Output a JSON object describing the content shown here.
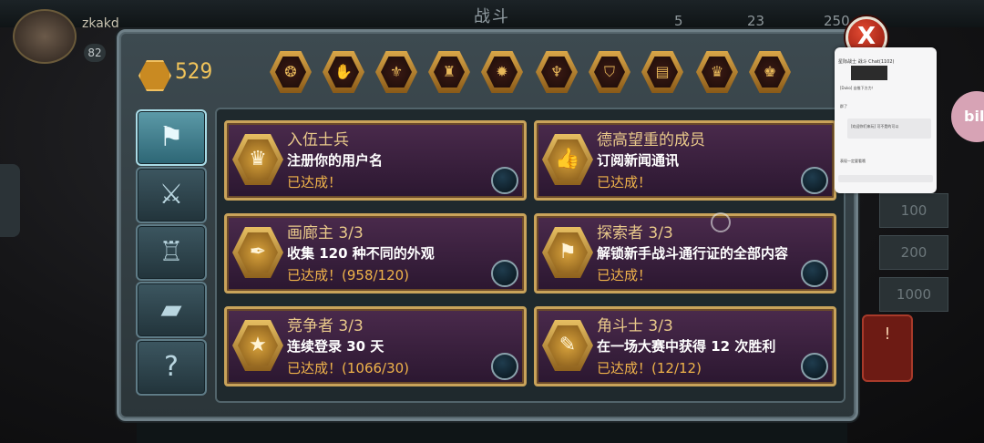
{
  "background": {
    "screen_title": "战斗",
    "username": "zkakd",
    "player_level": "82",
    "stats": [
      "5",
      "23",
      "250"
    ],
    "costs": [
      "100",
      "200",
      "1000"
    ],
    "side_logo": "bili",
    "red_button_text": "!"
  },
  "header": {
    "coin_amount": "529",
    "close_symbol": "X",
    "badges": [
      {
        "icon": "wreath-icon",
        "glyph": "❂"
      },
      {
        "icon": "hand-icon",
        "glyph": "✋"
      },
      {
        "icon": "winged-helmet-icon",
        "glyph": "⚜"
      },
      {
        "icon": "helmet-icon",
        "glyph": "♜"
      },
      {
        "icon": "gear-skull-icon",
        "glyph": "✹"
      },
      {
        "icon": "wings-icon",
        "glyph": "♆"
      },
      {
        "icon": "shield-icon",
        "glyph": "⛉"
      },
      {
        "icon": "book-icon",
        "glyph": "▤"
      },
      {
        "icon": "eagle-icon",
        "glyph": "♛"
      },
      {
        "icon": "crown-icon",
        "glyph": "♚"
      }
    ]
  },
  "sidebar": {
    "items": [
      {
        "id": "banner",
        "glyph": "⚑",
        "active": true
      },
      {
        "id": "swords",
        "glyph": "⚔",
        "active": false
      },
      {
        "id": "armor",
        "glyph": "♖",
        "active": false
      },
      {
        "id": "cards",
        "glyph": "▰",
        "active": false
      },
      {
        "id": "help",
        "glyph": "?",
        "active": false
      }
    ]
  },
  "achievements": [
    {
      "title": "入伍士兵",
      "desc": "注册你的用户名",
      "status": "已达成！",
      "icon": "eagle-badge-icon",
      "glyph": "♛"
    },
    {
      "title": "德高望重的成员",
      "desc": "订阅新闻通讯",
      "status": "已达成！",
      "icon": "thumbs-up-icon",
      "glyph": "👍"
    },
    {
      "title": "画廊主 3/3",
      "desc": "收集 120 种不同的外观",
      "status": "已达成！(958/120)",
      "icon": "feather-icon",
      "glyph": "✒"
    },
    {
      "title": "探索者 3/3",
      "desc": "解锁新手战斗通行证的全部内容",
      "status": "已达成！",
      "icon": "flag-icon",
      "glyph": "⚑"
    },
    {
      "title": "竞争者 3/3",
      "desc": "连续登录 30 天",
      "status": "已达成！(1066/30)",
      "icon": "stars-icon",
      "glyph": "★"
    },
    {
      "title": "角斗士 3/3",
      "desc": "在一场大赛中获得 12 次胜利",
      "status": "已达成！(12/12)",
      "icon": "ticket-icon",
      "glyph": "✎"
    }
  ],
  "overlay": {
    "header": "星际战士 战斗  Chat(1102)",
    "lines": [
      "[Duko] 自推下方力！",
      "群了",
      "[欢迎你们来玩] 可不是的可以",
      "表现一定要看哦"
    ]
  },
  "colors": {
    "card_border": "#c9a35a",
    "status_text": "#f0b34a",
    "title_text": "#e9c98a",
    "card_bg": "#3a2040",
    "close_red": "#c2301c"
  }
}
